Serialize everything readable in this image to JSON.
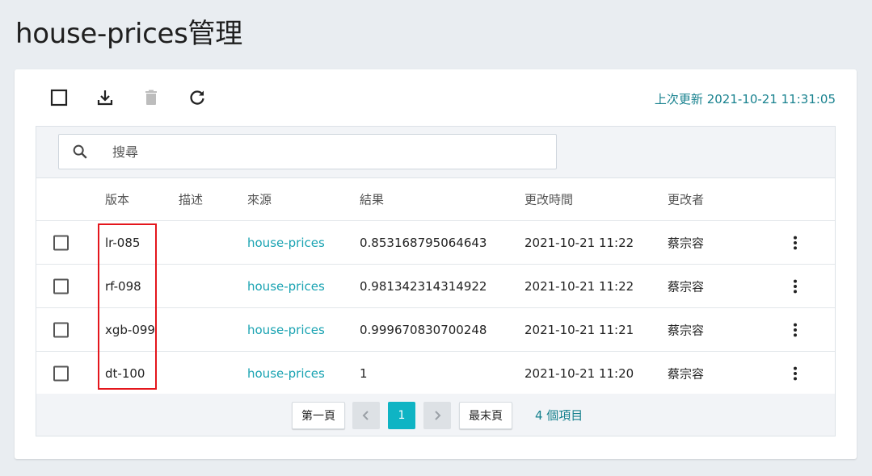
{
  "page": {
    "title": "house-prices管理"
  },
  "toolbar": {
    "last_updated": "上次更新 2021-10-21 11:31:05",
    "icons": [
      "checkbox-icon",
      "download-icon",
      "trash-icon",
      "refresh-icon"
    ]
  },
  "search": {
    "placeholder": "搜尋",
    "value": ""
  },
  "table": {
    "columns": [
      "版本",
      "描述",
      "來源",
      "結果",
      "更改時間",
      "更改者"
    ],
    "rows": [
      {
        "version": "lr-085",
        "description": "",
        "source": "house-prices",
        "result": "0.853168795064643",
        "time": "2021-10-21 11:22",
        "user": "蔡宗容"
      },
      {
        "version": "rf-098",
        "description": "",
        "source": "house-prices",
        "result": "0.981342314314922",
        "time": "2021-10-21 11:22",
        "user": "蔡宗容"
      },
      {
        "version": "xgb-099",
        "description": "",
        "source": "house-prices",
        "result": "0.999670830700248",
        "time": "2021-10-21 11:21",
        "user": "蔡宗容"
      },
      {
        "version": "dt-100",
        "description": "",
        "source": "house-prices",
        "result": "1",
        "time": "2021-10-21 11:20",
        "user": "蔡宗容"
      }
    ]
  },
  "pagination": {
    "first": "第一頁",
    "current": "1",
    "last": "最末頁",
    "count": "4 個項目"
  },
  "colors": {
    "accent": "#0fb4c4",
    "link": "#1aa3b2",
    "highlight": "#e4161c"
  }
}
